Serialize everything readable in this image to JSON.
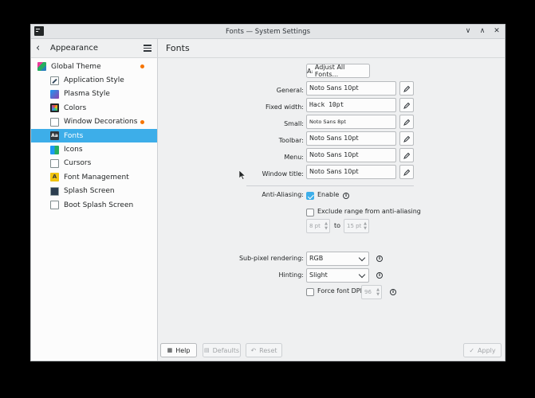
{
  "window": {
    "title": "Fonts — System Settings"
  },
  "sidebar": {
    "title": "Appearance",
    "items": [
      {
        "label": "Global Theme",
        "icon": "global-theme-icon",
        "level": 0,
        "modified": true,
        "selected": false
      },
      {
        "label": "Application Style",
        "icon": "application-style-icon",
        "level": 1,
        "modified": false,
        "selected": false
      },
      {
        "label": "Plasma Style",
        "icon": "plasma-style-icon",
        "level": 1,
        "modified": false,
        "selected": false
      },
      {
        "label": "Colors",
        "icon": "colors-icon",
        "level": 1,
        "modified": false,
        "selected": false
      },
      {
        "label": "Window Decorations",
        "icon": "window-decorations-icon",
        "level": 1,
        "modified": true,
        "selected": false
      },
      {
        "label": "Fonts",
        "icon": "fonts-icon",
        "level": 1,
        "modified": false,
        "selected": true
      },
      {
        "label": "Icons",
        "icon": "icons-icon",
        "level": 1,
        "modified": false,
        "selected": false
      },
      {
        "label": "Cursors",
        "icon": "cursors-icon",
        "level": 1,
        "modified": false,
        "selected": false
      },
      {
        "label": "Font Management",
        "icon": "font-management-icon",
        "level": 1,
        "modified": false,
        "selected": false
      },
      {
        "label": "Splash Screen",
        "icon": "splash-screen-icon",
        "level": 1,
        "modified": false,
        "selected": false
      },
      {
        "label": "Boot Splash Screen",
        "icon": "boot-splash-screen-icon",
        "level": 1,
        "modified": false,
        "selected": false
      }
    ]
  },
  "main": {
    "title": "Fonts",
    "adjust_all_label": "Adjust All Fonts...",
    "fonts": {
      "general": {
        "label": "General:",
        "value": "Noto Sans 10pt"
      },
      "fixed": {
        "label": "Fixed width:",
        "value": "Hack 10pt"
      },
      "small": {
        "label": "Small:",
        "value": "Noto Sans 8pt"
      },
      "toolbar": {
        "label": "Toolbar:",
        "value": "Noto Sans 10pt"
      },
      "menu": {
        "label": "Menu:",
        "value": "Noto Sans 10pt"
      },
      "window_title": {
        "label": "Window title:",
        "value": "Noto Sans 10pt"
      }
    },
    "antialiasing": {
      "label": "Anti-Aliasing:",
      "enable_label": "Enable",
      "enable_checked": true,
      "exclude_label": "Exclude range from anti-aliasing",
      "exclude_checked": false,
      "range_from": "8 pt",
      "range_to_label": "to",
      "range_to": "15 pt"
    },
    "subpixel": {
      "label": "Sub-pixel rendering:",
      "value": "RGB"
    },
    "hinting": {
      "label": "Hinting:",
      "value": "Slight"
    },
    "force_dpi": {
      "label": "Force font DPI:",
      "checked": false,
      "value": "96"
    }
  },
  "footer": {
    "help_label": "Help",
    "defaults_label": "Defaults",
    "reset_label": "Reset",
    "apply_label": "Apply"
  },
  "colors": {
    "accent": "#3daee9",
    "modified_dot": "#f67400"
  }
}
